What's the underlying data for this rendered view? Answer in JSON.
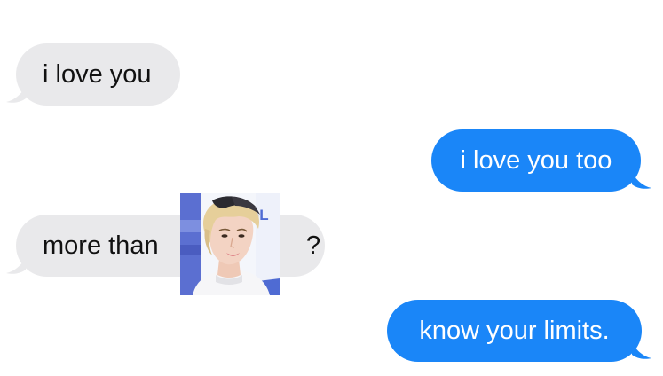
{
  "conversation": {
    "messages": [
      {
        "sender": "other",
        "text": "i love you"
      },
      {
        "sender": "me",
        "text": "i love you too"
      },
      {
        "sender": "other",
        "text_before": "more than",
        "image": "person-photo",
        "text_after": "?"
      },
      {
        "sender": "me",
        "text": "know your limits."
      }
    ],
    "photo_backdrop_text": "GL"
  },
  "colors": {
    "received_bubble": "#e9e9eb",
    "sent_bubble": "#1a86f8",
    "received_text": "#111111",
    "sent_text": "#ffffff",
    "background": "#ffffff"
  }
}
